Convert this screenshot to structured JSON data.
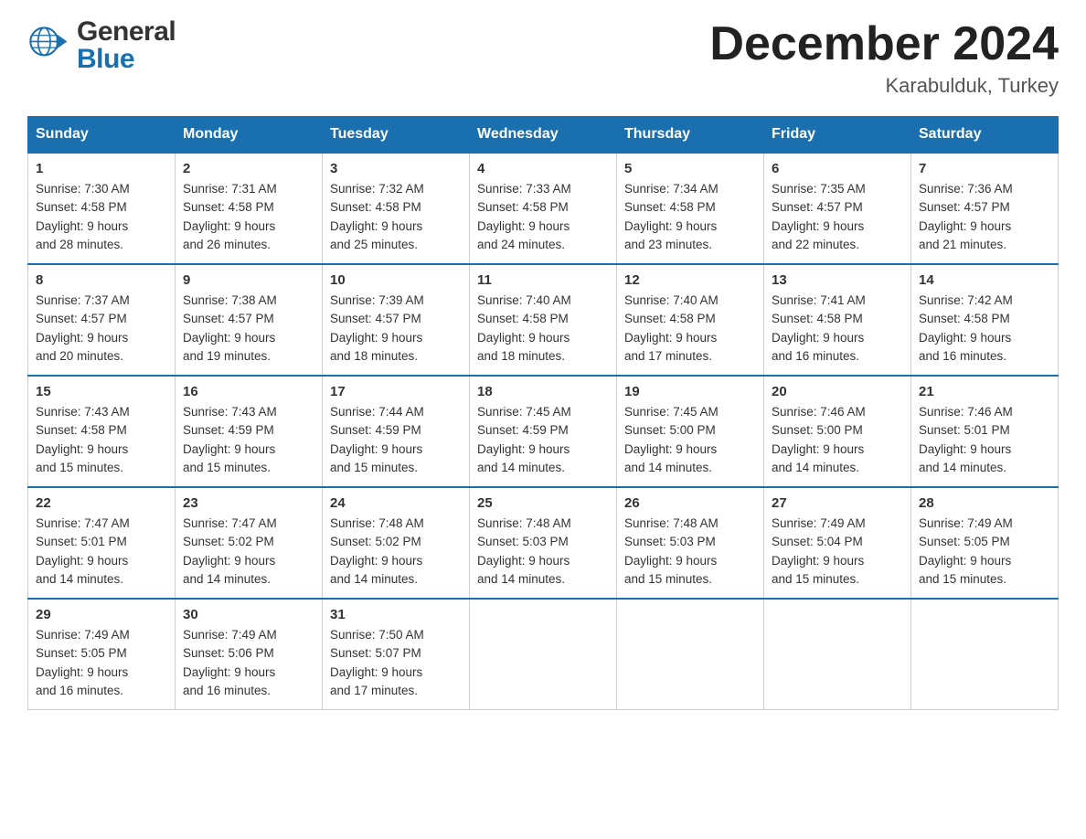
{
  "header": {
    "logo_general": "General",
    "logo_blue": "Blue",
    "month_title": "December 2024",
    "location": "Karabulduk, Turkey"
  },
  "calendar": {
    "days_of_week": [
      "Sunday",
      "Monday",
      "Tuesday",
      "Wednesday",
      "Thursday",
      "Friday",
      "Saturday"
    ],
    "weeks": [
      [
        {
          "day": "1",
          "sunrise": "7:30 AM",
          "sunset": "4:58 PM",
          "daylight": "9 hours and 28 minutes."
        },
        {
          "day": "2",
          "sunrise": "7:31 AM",
          "sunset": "4:58 PM",
          "daylight": "9 hours and 26 minutes."
        },
        {
          "day": "3",
          "sunrise": "7:32 AM",
          "sunset": "4:58 PM",
          "daylight": "9 hours and 25 minutes."
        },
        {
          "day": "4",
          "sunrise": "7:33 AM",
          "sunset": "4:58 PM",
          "daylight": "9 hours and 24 minutes."
        },
        {
          "day": "5",
          "sunrise": "7:34 AM",
          "sunset": "4:58 PM",
          "daylight": "9 hours and 23 minutes."
        },
        {
          "day": "6",
          "sunrise": "7:35 AM",
          "sunset": "4:57 PM",
          "daylight": "9 hours and 22 minutes."
        },
        {
          "day": "7",
          "sunrise": "7:36 AM",
          "sunset": "4:57 PM",
          "daylight": "9 hours and 21 minutes."
        }
      ],
      [
        {
          "day": "8",
          "sunrise": "7:37 AM",
          "sunset": "4:57 PM",
          "daylight": "9 hours and 20 minutes."
        },
        {
          "day": "9",
          "sunrise": "7:38 AM",
          "sunset": "4:57 PM",
          "daylight": "9 hours and 19 minutes."
        },
        {
          "day": "10",
          "sunrise": "7:39 AM",
          "sunset": "4:57 PM",
          "daylight": "9 hours and 18 minutes."
        },
        {
          "day": "11",
          "sunrise": "7:40 AM",
          "sunset": "4:58 PM",
          "daylight": "9 hours and 18 minutes."
        },
        {
          "day": "12",
          "sunrise": "7:40 AM",
          "sunset": "4:58 PM",
          "daylight": "9 hours and 17 minutes."
        },
        {
          "day": "13",
          "sunrise": "7:41 AM",
          "sunset": "4:58 PM",
          "daylight": "9 hours and 16 minutes."
        },
        {
          "day": "14",
          "sunrise": "7:42 AM",
          "sunset": "4:58 PM",
          "daylight": "9 hours and 16 minutes."
        }
      ],
      [
        {
          "day": "15",
          "sunrise": "7:43 AM",
          "sunset": "4:58 PM",
          "daylight": "9 hours and 15 minutes."
        },
        {
          "day": "16",
          "sunrise": "7:43 AM",
          "sunset": "4:59 PM",
          "daylight": "9 hours and 15 minutes."
        },
        {
          "day": "17",
          "sunrise": "7:44 AM",
          "sunset": "4:59 PM",
          "daylight": "9 hours and 15 minutes."
        },
        {
          "day": "18",
          "sunrise": "7:45 AM",
          "sunset": "4:59 PM",
          "daylight": "9 hours and 14 minutes."
        },
        {
          "day": "19",
          "sunrise": "7:45 AM",
          "sunset": "5:00 PM",
          "daylight": "9 hours and 14 minutes."
        },
        {
          "day": "20",
          "sunrise": "7:46 AM",
          "sunset": "5:00 PM",
          "daylight": "9 hours and 14 minutes."
        },
        {
          "day": "21",
          "sunrise": "7:46 AM",
          "sunset": "5:01 PM",
          "daylight": "9 hours and 14 minutes."
        }
      ],
      [
        {
          "day": "22",
          "sunrise": "7:47 AM",
          "sunset": "5:01 PM",
          "daylight": "9 hours and 14 minutes."
        },
        {
          "day": "23",
          "sunrise": "7:47 AM",
          "sunset": "5:02 PM",
          "daylight": "9 hours and 14 minutes."
        },
        {
          "day": "24",
          "sunrise": "7:48 AM",
          "sunset": "5:02 PM",
          "daylight": "9 hours and 14 minutes."
        },
        {
          "day": "25",
          "sunrise": "7:48 AM",
          "sunset": "5:03 PM",
          "daylight": "9 hours and 14 minutes."
        },
        {
          "day": "26",
          "sunrise": "7:48 AM",
          "sunset": "5:03 PM",
          "daylight": "9 hours and 15 minutes."
        },
        {
          "day": "27",
          "sunrise": "7:49 AM",
          "sunset": "5:04 PM",
          "daylight": "9 hours and 15 minutes."
        },
        {
          "day": "28",
          "sunrise": "7:49 AM",
          "sunset": "5:05 PM",
          "daylight": "9 hours and 15 minutes."
        }
      ],
      [
        {
          "day": "29",
          "sunrise": "7:49 AM",
          "sunset": "5:05 PM",
          "daylight": "9 hours and 16 minutes."
        },
        {
          "day": "30",
          "sunrise": "7:49 AM",
          "sunset": "5:06 PM",
          "daylight": "9 hours and 16 minutes."
        },
        {
          "day": "31",
          "sunrise": "7:50 AM",
          "sunset": "5:07 PM",
          "daylight": "9 hours and 17 minutes."
        },
        null,
        null,
        null,
        null
      ]
    ],
    "labels": {
      "sunrise": "Sunrise:",
      "sunset": "Sunset:",
      "daylight": "Daylight:"
    }
  }
}
